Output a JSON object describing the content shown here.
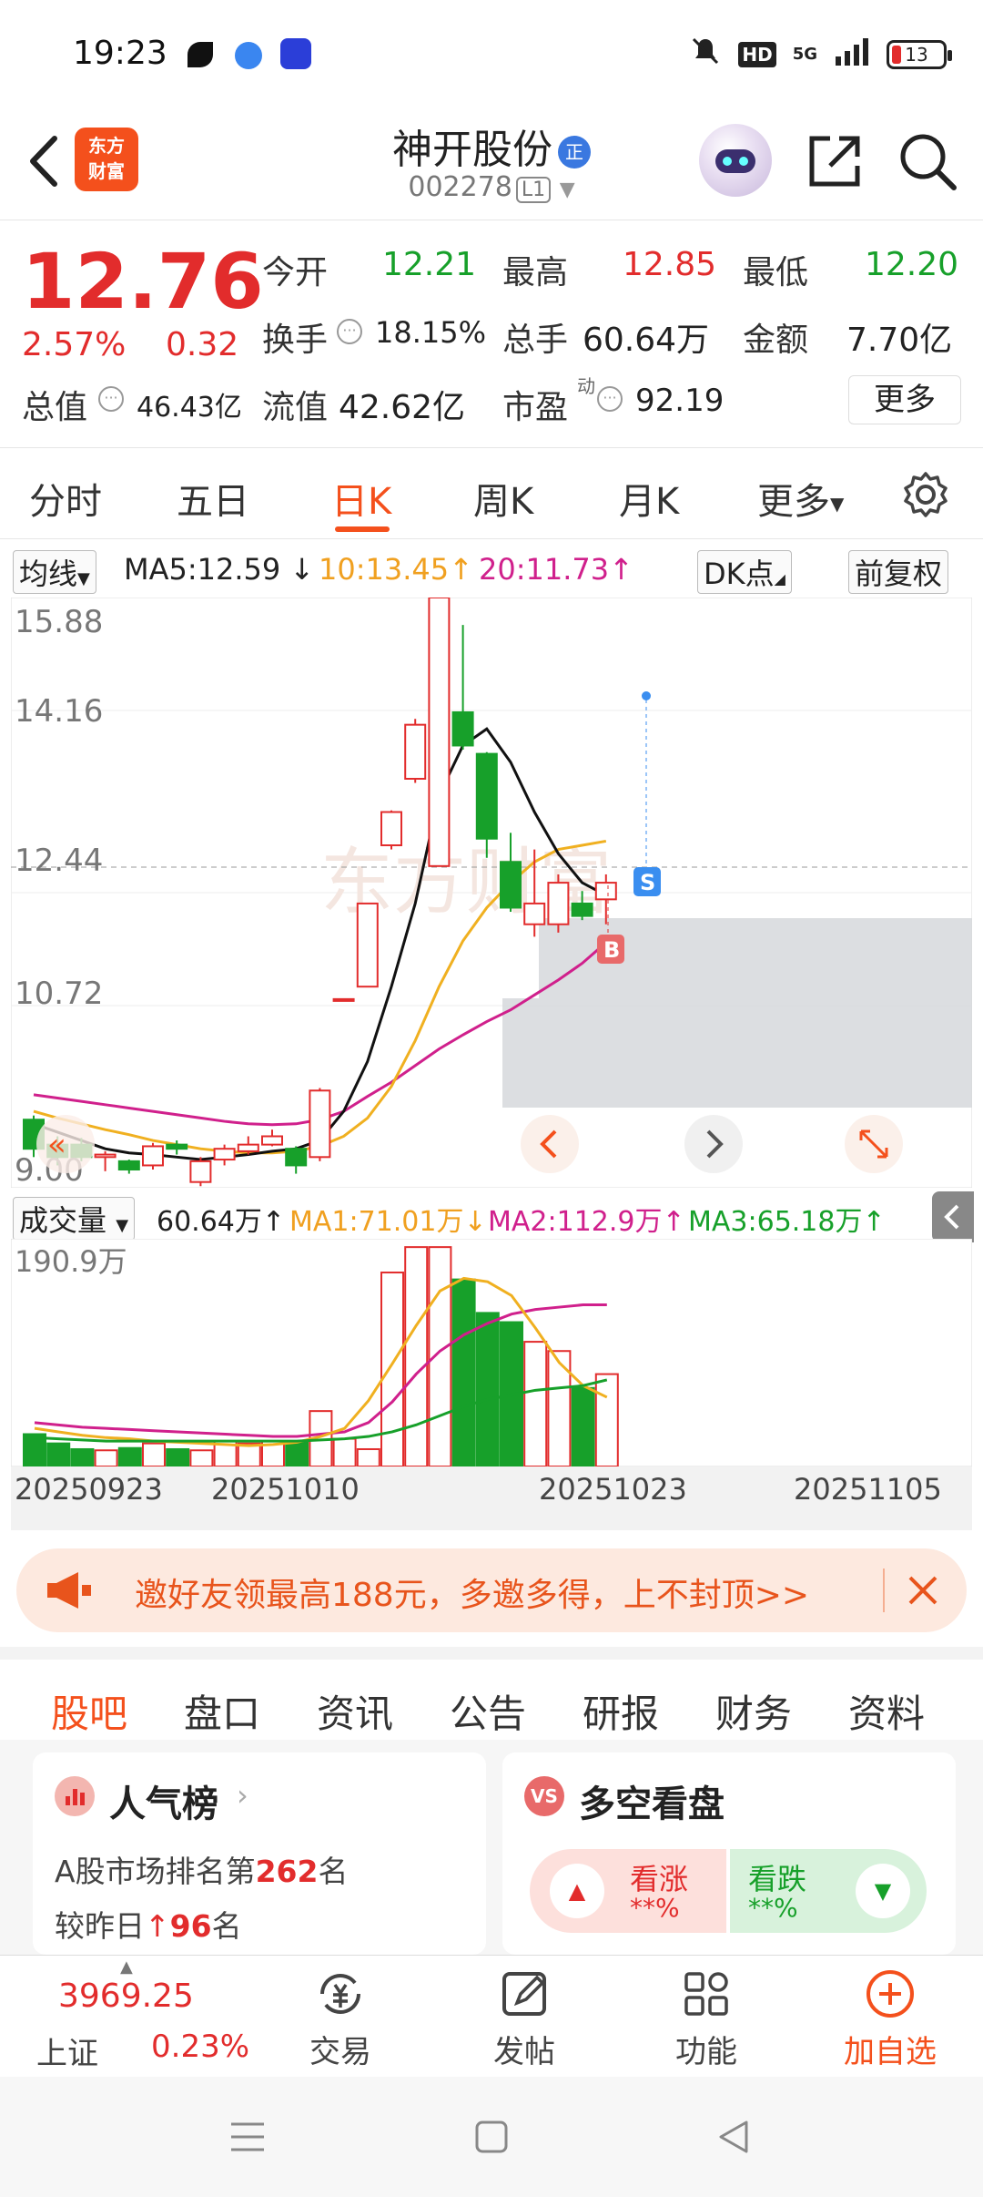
{
  "status_bar": {
    "time": "19:23",
    "network": "5G",
    "hd_label": "HD",
    "battery": "13"
  },
  "header": {
    "logo_text_1": "东方",
    "logo_text_2": "财富",
    "stock_name": "神开股份",
    "name_tag": "正",
    "stock_code": "002278",
    "level": "L1"
  },
  "quote": {
    "price": "12.76",
    "pct_change": "2.57%",
    "change": "0.32",
    "open_label": "今开",
    "open": "12.21",
    "high_label": "最高",
    "high": "12.85",
    "low_label": "最低",
    "low": "12.20",
    "turnover_label": "换手",
    "turnover": "18.15%",
    "volume_label": "总手",
    "volume": "60.64万",
    "amount_label": "金额",
    "amount": "7.70亿",
    "mktcap_label": "总值",
    "mktcap": "46.43亿",
    "float_label": "流值",
    "float_cap": "42.62亿",
    "pe_label": "市盈",
    "pe_sup": "动",
    "pe": "92.19",
    "more": "更多"
  },
  "period_tabs": [
    "分时",
    "五日",
    "日K",
    "周K",
    "月K",
    "更多"
  ],
  "active_tab": "日K",
  "ma_bar": {
    "selector": "均线",
    "ma5": "MA5:12.59",
    "ma10": "10:13.45",
    "ma20": "20:11.73",
    "dk": "DK点",
    "adjust": "前复权"
  },
  "price_axis": [
    "15.88",
    "14.16",
    "12.44",
    "10.72",
    "9.00"
  ],
  "chart_markers": {
    "buy": "B",
    "sell": "S"
  },
  "watermark": "东方财富",
  "chart_data": {
    "type": "candlestick",
    "ylim": [
      9.0,
      15.88
    ],
    "candles": [
      {
        "o": 9.6,
        "c": 9.25,
        "h": 9.65,
        "l": 9.15
      },
      {
        "o": 9.3,
        "c": 9.15,
        "h": 9.4,
        "l": 9.05
      },
      {
        "o": 9.3,
        "c": 9.15,
        "h": 9.38,
        "l": 9.1
      },
      {
        "o": 9.15,
        "c": 9.18,
        "h": 9.22,
        "l": 8.98
      },
      {
        "o": 9.1,
        "c": 9.0,
        "h": 9.12,
        "l": 8.95
      },
      {
        "o": 9.05,
        "c": 9.28,
        "h": 9.32,
        "l": 9.0
      },
      {
        "o": 9.3,
        "c": 9.25,
        "h": 9.35,
        "l": 9.18
      },
      {
        "o": 8.85,
        "c": 9.1,
        "h": 9.15,
        "l": 8.8
      },
      {
        "o": 9.12,
        "c": 9.25,
        "h": 9.3,
        "l": 9.05
      },
      {
        "o": 9.22,
        "c": 9.3,
        "h": 9.4,
        "l": 9.18
      },
      {
        "o": 9.3,
        "c": 9.4,
        "h": 9.48,
        "l": 9.28
      },
      {
        "o": 9.25,
        "c": 9.05,
        "h": 9.28,
        "l": 8.95
      },
      {
        "o": 9.15,
        "c": 9.95,
        "h": 9.98,
        "l": 9.1
      },
      {
        "o": 11.05,
        "c": 11.05,
        "h": 11.05,
        "l": 11.05
      },
      {
        "o": 11.2,
        "c": 12.2,
        "h": 12.2,
        "l": 11.2
      },
      {
        "o": 12.9,
        "c": 13.3,
        "h": 13.32,
        "l": 12.85
      },
      {
        "o": 13.7,
        "c": 14.35,
        "h": 14.42,
        "l": 13.65
      },
      {
        "o": 12.65,
        "c": 15.88,
        "h": 15.88,
        "l": 12.65
      },
      {
        "o": 14.5,
        "c": 14.1,
        "h": 15.55,
        "l": 14.05
      },
      {
        "o": 14.0,
        "c": 12.98,
        "h": 14.02,
        "l": 12.75
      },
      {
        "o": 12.7,
        "c": 12.15,
        "h": 13.05,
        "l": 12.1
      },
      {
        "o": 11.95,
        "c": 12.2,
        "h": 12.85,
        "l": 11.8
      },
      {
        "o": 11.95,
        "c": 12.45,
        "h": 12.55,
        "l": 11.85
      },
      {
        "o": 12.2,
        "c": 12.05,
        "h": 12.35,
        "l": 12.0
      },
      {
        "o": 12.25,
        "c": 12.45,
        "h": 12.55,
        "l": 11.95
      }
    ],
    "ma5": [
      9.55,
      9.45,
      9.35,
      9.25,
      9.2,
      9.18,
      9.15,
      9.12,
      9.15,
      9.18,
      9.22,
      9.25,
      9.35,
      9.7,
      10.3,
      11.2,
      12.2,
      13.5,
      14.1,
      14.3,
      13.9,
      13.3,
      12.8,
      12.45,
      12.3
    ],
    "ma10": [
      9.7,
      9.62,
      9.55,
      9.48,
      9.42,
      9.35,
      9.3,
      9.25,
      9.22,
      9.2,
      9.2,
      9.22,
      9.28,
      9.4,
      9.62,
      10.0,
      10.55,
      11.2,
      11.75,
      12.15,
      12.45,
      12.7,
      12.85,
      12.9,
      12.95
    ],
    "ma20": [
      9.9,
      9.86,
      9.82,
      9.78,
      9.74,
      9.7,
      9.66,
      9.62,
      9.58,
      9.55,
      9.54,
      9.55,
      9.6,
      9.7,
      9.88,
      10.05,
      10.25,
      10.45,
      10.62,
      10.78,
      10.92,
      11.1,
      11.28,
      11.48,
      11.73
    ]
  },
  "volume_bar": {
    "selector": "成交量",
    "vol": "60.64万",
    "ma1": "MA1:71.01万",
    "ma2": "MA2:112.9万",
    "ma3": "MA3:65.18万"
  },
  "volume_axis_max": "190.9万",
  "volume_data": {
    "ylim": [
      0,
      190.9
    ],
    "values": [
      28,
      20,
      15,
      14,
      16,
      20,
      15,
      14,
      22,
      20,
      22,
      21,
      48,
      24,
      15,
      168,
      190,
      190,
      162,
      133,
      125,
      108,
      100,
      68,
      80
    ],
    "ma1": [
      33,
      30,
      27,
      25,
      24,
      22,
      21,
      20,
      19,
      18,
      19,
      21,
      26,
      33,
      57,
      89,
      122,
      152,
      163,
      160,
      148,
      120,
      90,
      70,
      60
    ],
    "ma2": [
      38,
      36,
      34,
      33,
      32,
      31,
      30,
      29,
      28,
      27,
      26,
      26,
      28,
      30,
      38,
      56,
      80,
      100,
      114,
      124,
      132,
      136,
      138,
      140,
      140
    ],
    "ma3": [
      25,
      24,
      23,
      22,
      22,
      22,
      22,
      22,
      22,
      22,
      22,
      22,
      23,
      24,
      26,
      30,
      36,
      44,
      52,
      58,
      62,
      66,
      68,
      70,
      75
    ]
  },
  "date_labels": [
    "20250923",
    "20251010",
    "20251023",
    "20251105"
  ],
  "promo": {
    "text": "邀好友领最高188元，多邀多得，上不封顶>>"
  },
  "section_tabs": [
    "股吧",
    "盘口",
    "资讯",
    "公告",
    "研报",
    "财务",
    "资料"
  ],
  "cards": {
    "popularity_title": "人气榜",
    "rank_text_1": "A股市场排名第",
    "rank_value": "262",
    "rank_text_2": "名",
    "vs_yesterday_1": "较昨日",
    "vs_value": "96",
    "vs_yesterday_2": "名",
    "vs_title": "多空看盘",
    "bull_label": "看涨",
    "bull_pct": "**%",
    "bear_label": "看跌",
    "bear_pct": "**%"
  },
  "bottom_nav": {
    "index_value": "3969.25",
    "index_name": "上证",
    "index_pct": "0.23%",
    "trade": "交易",
    "post": "发帖",
    "functions": "功能",
    "add_watch": "加自选"
  },
  "colors": {
    "up": "#e22c2c",
    "down": "#17a02a",
    "accent": "#f4501c",
    "ma10": "#f0b020",
    "ma20": "#d0208c"
  }
}
